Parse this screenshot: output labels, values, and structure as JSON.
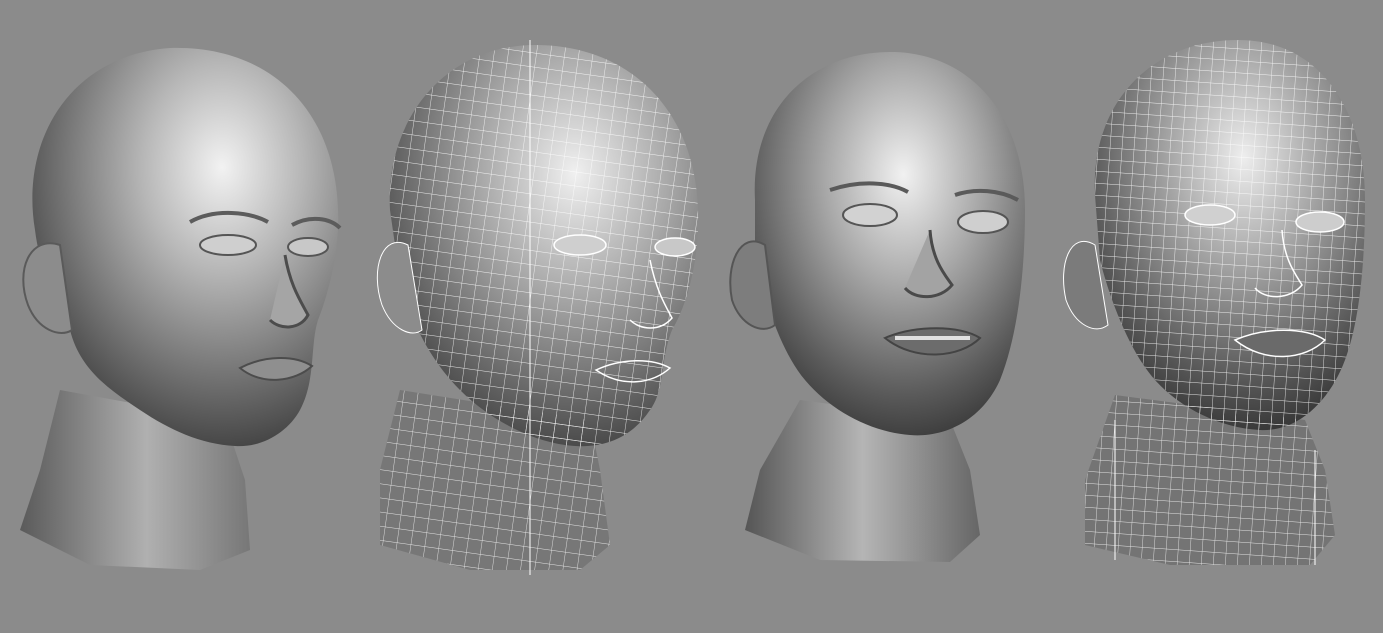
{
  "viewport": {
    "background_color": "#8b8b8b",
    "panels": [
      {
        "name": "head-female-shaded",
        "render_mode": "shaded"
      },
      {
        "name": "head-female-wireframe",
        "render_mode": "shaded-wireframe"
      },
      {
        "name": "head-child-shaded",
        "render_mode": "shaded"
      },
      {
        "name": "head-child-wireframe",
        "render_mode": "shaded-wireframe"
      }
    ],
    "colors": {
      "skin_light": "#e6e6e6",
      "skin_mid": "#9a9a9a",
      "skin_dark": "#4a4a4a",
      "wire": "#ffffff"
    }
  }
}
